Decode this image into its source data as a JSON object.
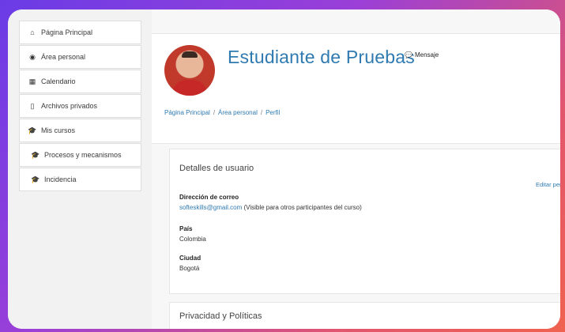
{
  "sidebar": {
    "items": [
      {
        "icon": "home-icon",
        "label": "Página Principal"
      },
      {
        "icon": "dashboard-icon",
        "label": "Área personal"
      },
      {
        "icon": "calendar-icon",
        "label": "Calendario"
      },
      {
        "icon": "file-icon",
        "label": "Archivos privados"
      },
      {
        "icon": "graduation-cap-icon",
        "label": "Mis cursos"
      },
      {
        "icon": "graduation-cap-icon",
        "label": "Procesos y mecanismos"
      },
      {
        "icon": "graduation-cap-icon",
        "label": "Incidencia"
      }
    ]
  },
  "profile": {
    "name": "Estudiante de Pruebas",
    "message_label": "Mensaje",
    "breadcrumb": [
      "Página Principal",
      "Área personal",
      "Perfil"
    ]
  },
  "details": {
    "title": "Detalles de usuario",
    "edit_label": "Editar perf",
    "email_label": "Dirección de correo",
    "email": "softeskills@gmail.com",
    "email_note": "(Visible para otros participantes del curso)",
    "country_label": "País",
    "country": "Colombia",
    "city_label": "Ciudad",
    "city": "Bogotá"
  },
  "privacy": {
    "title": "Privacidad y Políticas"
  },
  "colors": {
    "link": "#2f7ab0",
    "frame_start": "#6a3ce6",
    "frame_end": "#f0624f"
  }
}
